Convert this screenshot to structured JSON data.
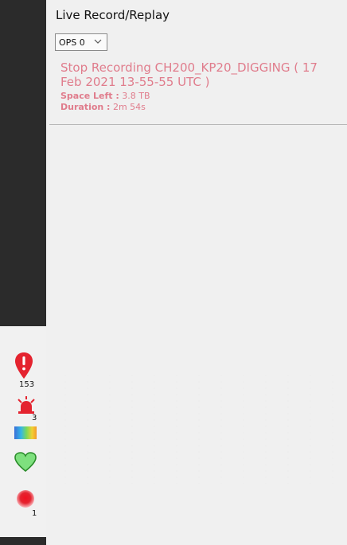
{
  "panel": {
    "title": "Live Record/Replay",
    "ops_select": {
      "value": "OPS 0"
    },
    "recording": {
      "title": "Stop Recording CH200_KP20_DIGGING ( 17 Feb 2021 13-55-55 UTC )",
      "space_left_label": "Space Left :",
      "space_left_value": "3.8 TB",
      "duration_label": "Duration :",
      "duration_value": "2m 54s"
    }
  },
  "side_status": {
    "alert_count": "153",
    "alarm_count": "3",
    "record_count": "1"
  },
  "colors": {
    "record_text": "#e07c8c",
    "alert_red": "#e4232f",
    "heart_green": "#7ee07e"
  },
  "icons": [
    "map-pin-alert-icon",
    "alarm-siren-icon",
    "heatmap-icon",
    "heart-health-icon",
    "record-dot-icon"
  ]
}
